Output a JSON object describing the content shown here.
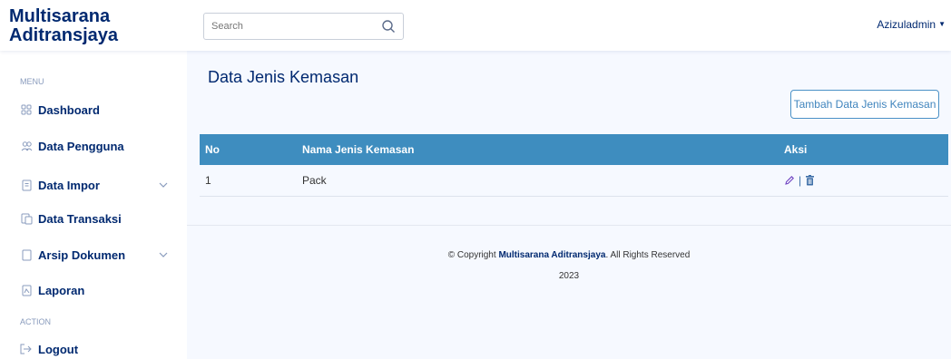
{
  "brand": {
    "line1": "Multisarana",
    "line2": "Aditransjaya"
  },
  "search": {
    "placeholder": "Search"
  },
  "user": {
    "name": "Azizuladmin"
  },
  "sidebar": {
    "menu_heading": "MENU",
    "action_heading": "ACTION",
    "items": [
      {
        "label": "Dashboard",
        "icon": "grid-icon"
      },
      {
        "label": "Data Pengguna",
        "icon": "users-icon"
      },
      {
        "label": "Data Impor",
        "icon": "document-icon",
        "expandable": true
      },
      {
        "label": "Data Transaksi",
        "icon": "transaction-icon"
      },
      {
        "label": "Arsip Dokumen",
        "icon": "archive-icon",
        "expandable": true
      },
      {
        "label": "Laporan",
        "icon": "report-icon"
      }
    ],
    "logout": {
      "label": "Logout",
      "icon": "logout-icon"
    }
  },
  "main": {
    "title": "Data Jenis Kemasan",
    "add_button": "Tambah Data Jenis Kemasan",
    "table": {
      "headers": {
        "no": "No",
        "name": "Nama Jenis Kemasan",
        "aksi": "Aksi"
      },
      "rows": [
        {
          "no": "1",
          "name": "Pack"
        }
      ],
      "separator": "|"
    }
  },
  "footer": {
    "prefix": "© Copyright ",
    "company": "Multisarana Aditransjaya",
    "suffix": ". All Rights Reserved",
    "year": "2023"
  },
  "colors": {
    "brand": "#012970",
    "table_header": "#3e8dbf",
    "button_border": "#4b91c6",
    "background": "#f6f9ff"
  }
}
